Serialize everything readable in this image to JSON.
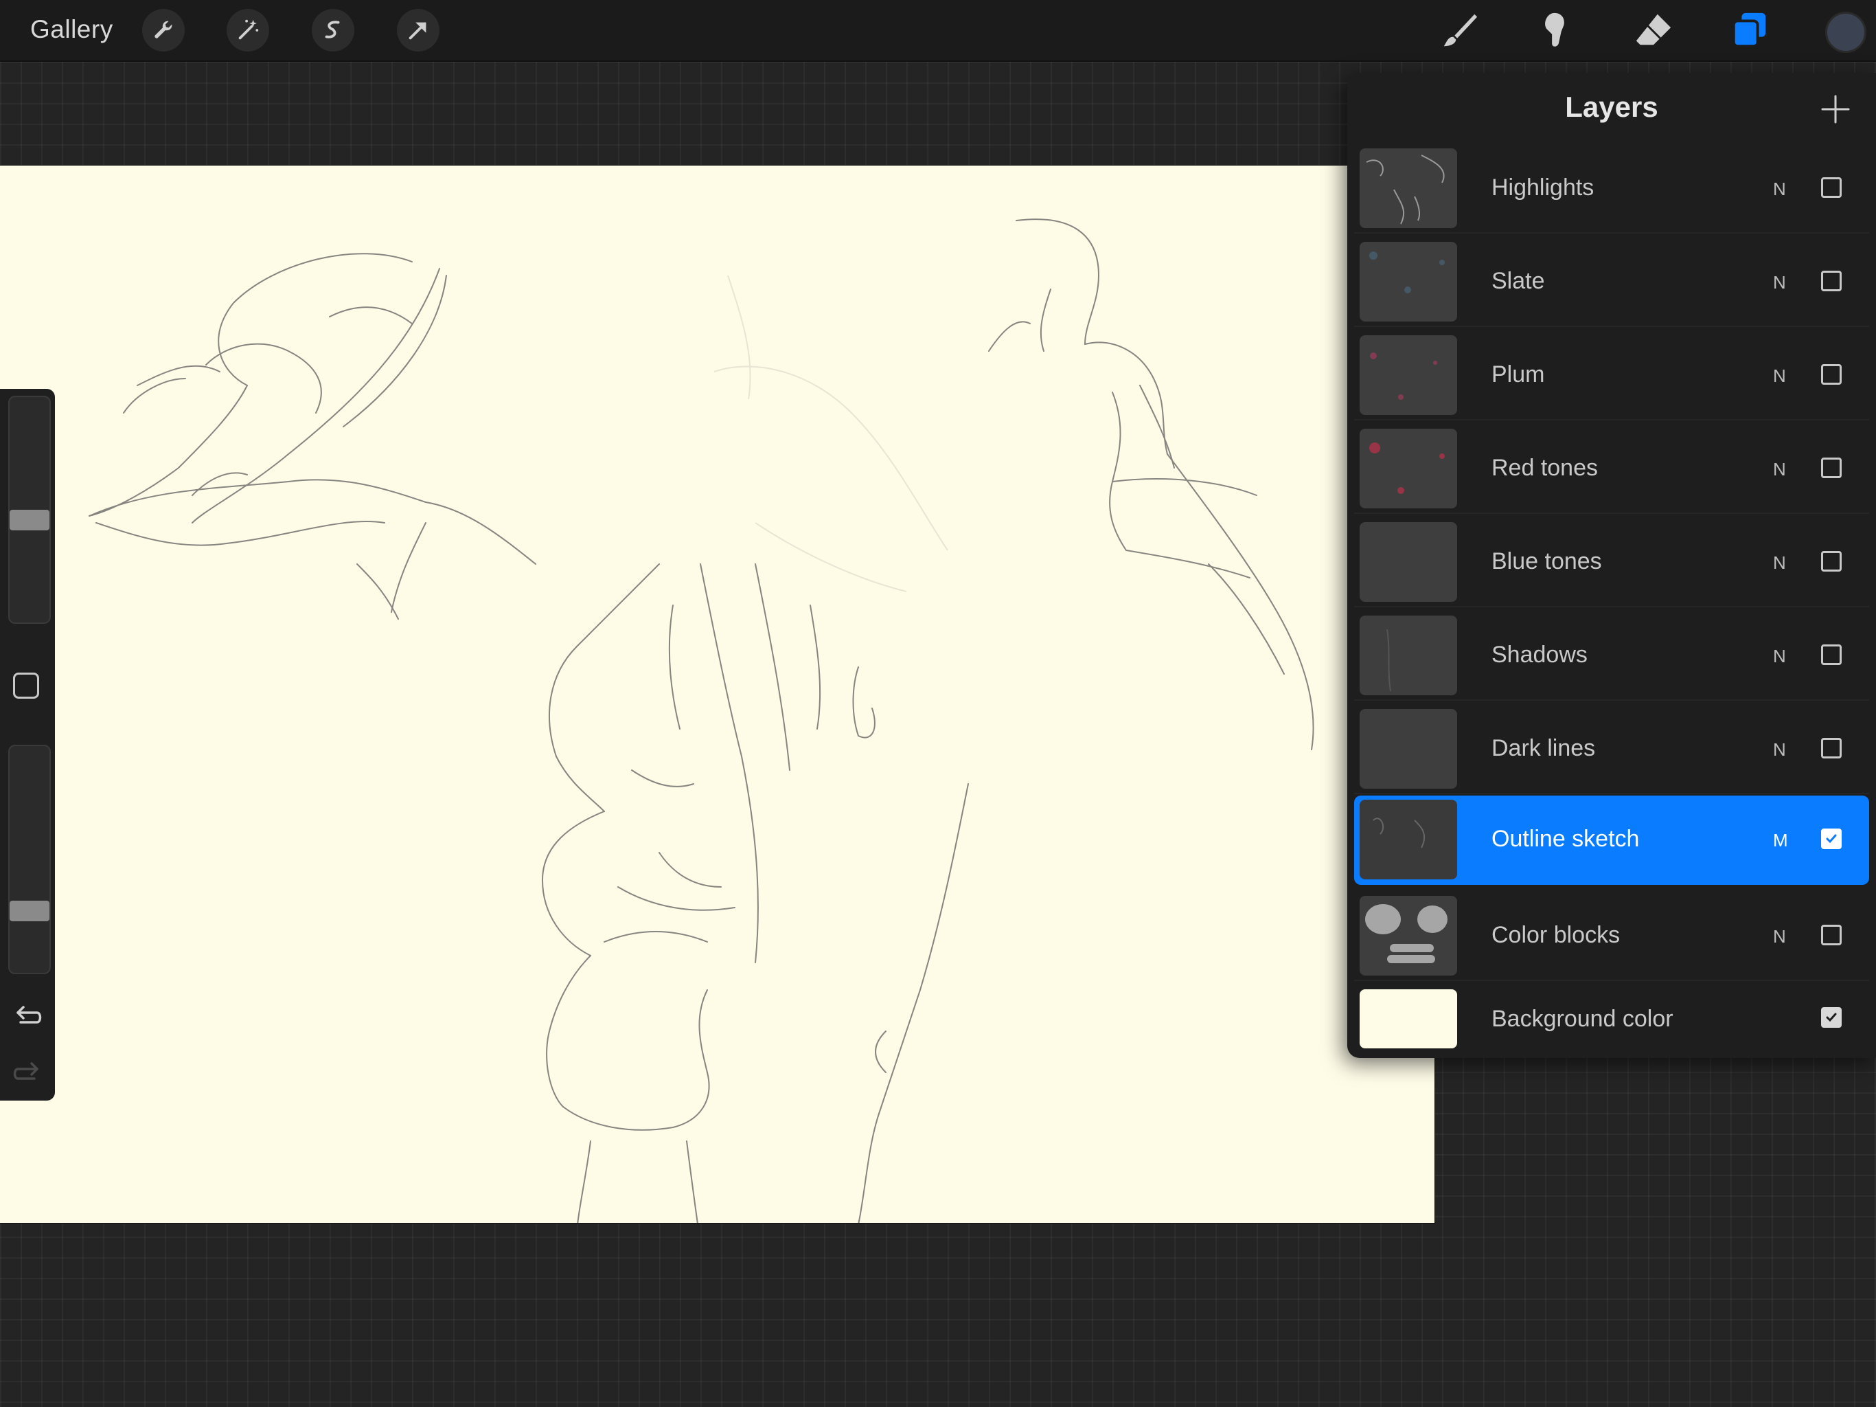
{
  "toolbar": {
    "gallery_label": "Gallery",
    "left_tools": [
      "wrench-icon",
      "magic-wand-icon",
      "selection-s-icon",
      "transform-arrow-icon"
    ],
    "right_tools": [
      "brush-icon",
      "smudge-icon",
      "eraser-icon",
      "layers-icon"
    ],
    "active_tool": "layers-icon",
    "accent_color": "#0a7cff",
    "current_color": "#3b4252"
  },
  "sidebar": {
    "brush_size_level": 0.55,
    "opacity_level": 0.75,
    "icons": [
      "modifier-square-icon",
      "undo-icon",
      "redo-icon"
    ]
  },
  "layers_panel": {
    "title": "Layers",
    "add_icon": "plus-icon",
    "layers": [
      {
        "name": "Highlights",
        "mode": "N",
        "visible": false,
        "selected": false
      },
      {
        "name": "Slate",
        "mode": "N",
        "visible": false,
        "selected": false
      },
      {
        "name": "Plum",
        "mode": "N",
        "visible": false,
        "selected": false
      },
      {
        "name": "Red tones",
        "mode": "N",
        "visible": false,
        "selected": false
      },
      {
        "name": "Blue tones",
        "mode": "N",
        "visible": false,
        "selected": false
      },
      {
        "name": "Shadows",
        "mode": "N",
        "visible": false,
        "selected": false
      },
      {
        "name": "Dark lines",
        "mode": "N",
        "visible": false,
        "selected": false
      },
      {
        "name": "Outline sketch",
        "mode": "M",
        "visible": true,
        "selected": true
      },
      {
        "name": "Color blocks",
        "mode": "N",
        "visible": false,
        "selected": false
      },
      {
        "name": "Background color",
        "mode": "",
        "visible": true,
        "selected": false
      }
    ]
  },
  "canvas": {
    "paper_color": "#fefbe7"
  }
}
